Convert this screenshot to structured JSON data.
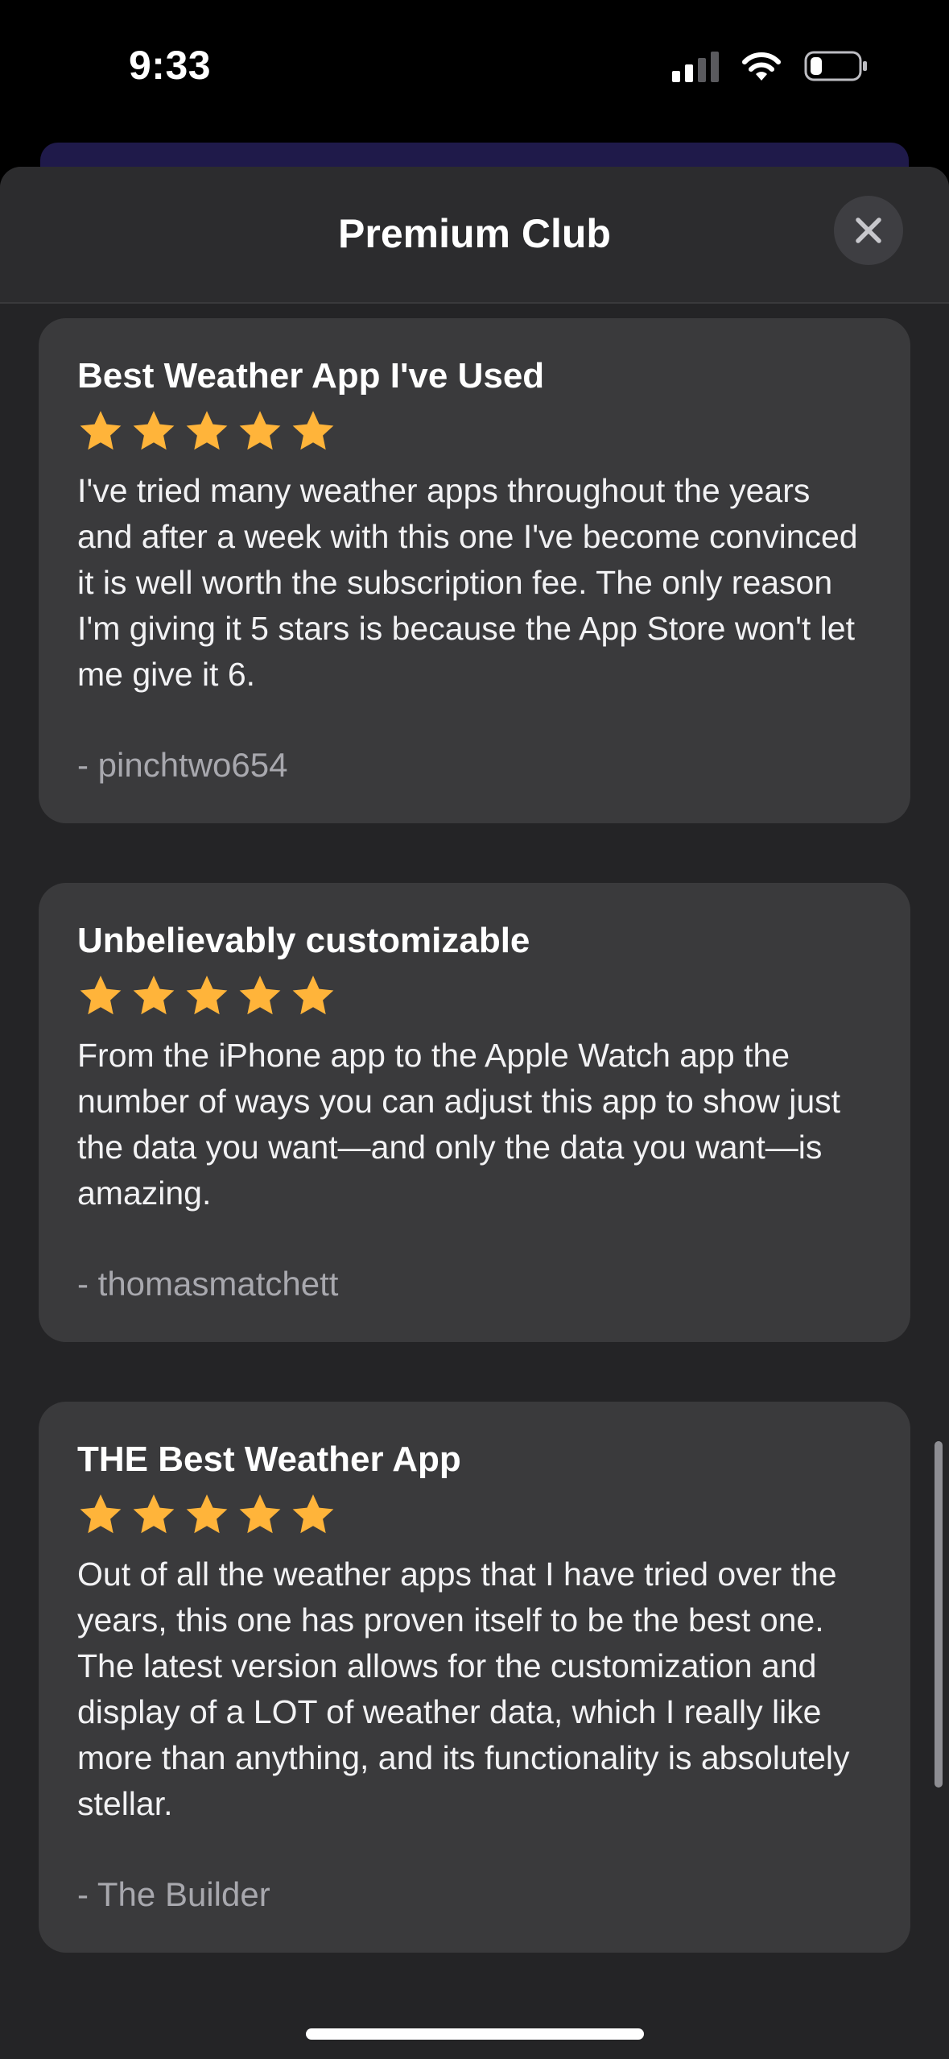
{
  "status_bar": {
    "time": "9:33"
  },
  "sheet": {
    "title": "Premium Club",
    "close_icon": "close-icon"
  },
  "colors": {
    "star": "#FFB43A",
    "card": "#3A3A3C",
    "sheet": "#242426",
    "header": "#2C2C2E"
  },
  "reviews": [
    {
      "title": "Best Weather App I've Used",
      "rating": 5,
      "body": "I've tried many weather apps throughout the years and after a week with this one I've become convinced it is well worth the subscription fee. The only reason I'm giving it 5 stars is because the App Store won't let me give it 6.",
      "author": "- pinchtwo654"
    },
    {
      "title": "Unbelievably customizable",
      "rating": 5,
      "body": "From the iPhone app to the Apple Watch app the number of ways you can adjust this app to show just the data you want—and only the data you want—is amazing.",
      "author": "- thomasmatchett"
    },
    {
      "title": "THE Best Weather App",
      "rating": 5,
      "body": "Out of all the weather apps that I have tried over the years, this one has proven itself to be the best one. The latest version allows for the customization and display of a LOT of weather data, which I really like more than anything, and its functionality is absolutely stellar.",
      "author": "- The Builder"
    }
  ]
}
